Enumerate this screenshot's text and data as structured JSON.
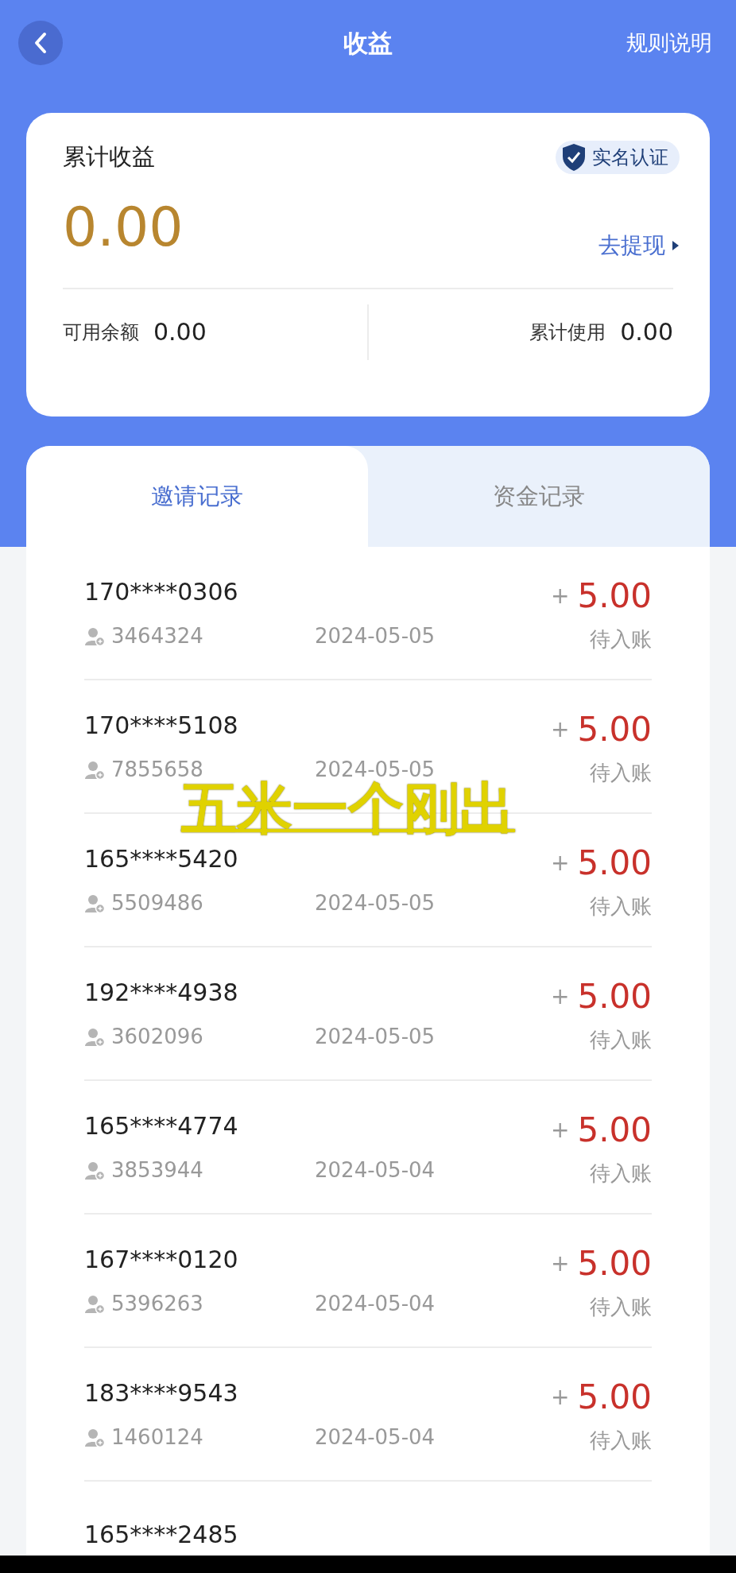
{
  "header": {
    "title": "收益",
    "rules_link": "规则说明"
  },
  "summary": {
    "title": "累计收益",
    "verified_badge": "实名认证",
    "total": "0.00",
    "withdraw_link": "去提现",
    "available_label": "可用余额",
    "available": "0.00",
    "used_label": "累计使用",
    "used": "0.00"
  },
  "tabs": [
    {
      "label": "邀请记录",
      "selected": true
    },
    {
      "label": "资金记录",
      "selected": false
    }
  ],
  "records": [
    {
      "phone": "170****0306",
      "user_id": "3464324",
      "date": "2024-05-05",
      "sign": "+",
      "amount": "5.00",
      "status": "待入账"
    },
    {
      "phone": "170****5108",
      "user_id": "7855658",
      "date": "2024-05-05",
      "sign": "+",
      "amount": "5.00",
      "status": "待入账"
    },
    {
      "phone": "165****5420",
      "user_id": "5509486",
      "date": "2024-05-05",
      "sign": "+",
      "amount": "5.00",
      "status": "待入账"
    },
    {
      "phone": "192****4938",
      "user_id": "3602096",
      "date": "2024-05-05",
      "sign": "+",
      "amount": "5.00",
      "status": "待入账"
    },
    {
      "phone": "165****4774",
      "user_id": "3853944",
      "date": "2024-05-04",
      "sign": "+",
      "amount": "5.00",
      "status": "待入账"
    },
    {
      "phone": "167****0120",
      "user_id": "5396263",
      "date": "2024-05-04",
      "sign": "+",
      "amount": "5.00",
      "status": "待入账"
    },
    {
      "phone": "183****9543",
      "user_id": "1460124",
      "date": "2024-05-04",
      "sign": "+",
      "amount": "5.00",
      "status": "待入账"
    }
  ],
  "partial_record": {
    "phone": "165****2485"
  },
  "overlay_caption": "五米一个刚出"
}
